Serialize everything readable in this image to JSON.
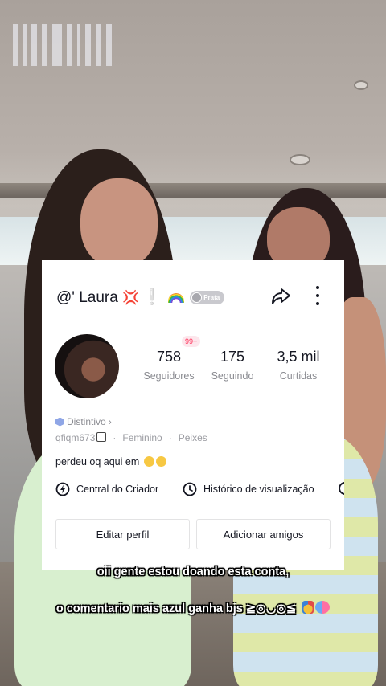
{
  "profile": {
    "username": "@' Laura",
    "level_badge": "Prata",
    "avatar_alt": "",
    "stats": [
      {
        "value": "758",
        "label": "Seguidores"
      },
      {
        "value": "175",
        "label": "Seguindo"
      },
      {
        "value": "3,5 mil",
        "label": "Curtidas"
      }
    ],
    "notification_badge": "99+",
    "distintivo": "Distintivo",
    "handle": "qfiqm673",
    "gender": "Feminino",
    "sign": "Peixes",
    "bio": "perdeu oq aqui em",
    "creator_center": "Central do Criador",
    "history": "Histórico de visualização",
    "edit_profile": "Editar perfil",
    "add_friends": "Adicionar amigos"
  },
  "subtitles": {
    "line1": "oii gente estou doando esta conta,",
    "line2": "o comentario mais azul ganha  bjs ≧◎◡◎≦"
  },
  "colors": {
    "card_bg": "#ffffff",
    "text_primary": "#161823",
    "text_secondary": "#8a8b91",
    "accent_pink": "#fe2c55",
    "button_border": "#e3e3e4"
  },
  "icons": [
    "share-icon",
    "more-icon",
    "shield-icon",
    "edit-icon",
    "creator-center-icon",
    "history-icon",
    "anger-emoji-icon",
    "rainbow-icon",
    "medal-icon",
    "masks-icon"
  ]
}
